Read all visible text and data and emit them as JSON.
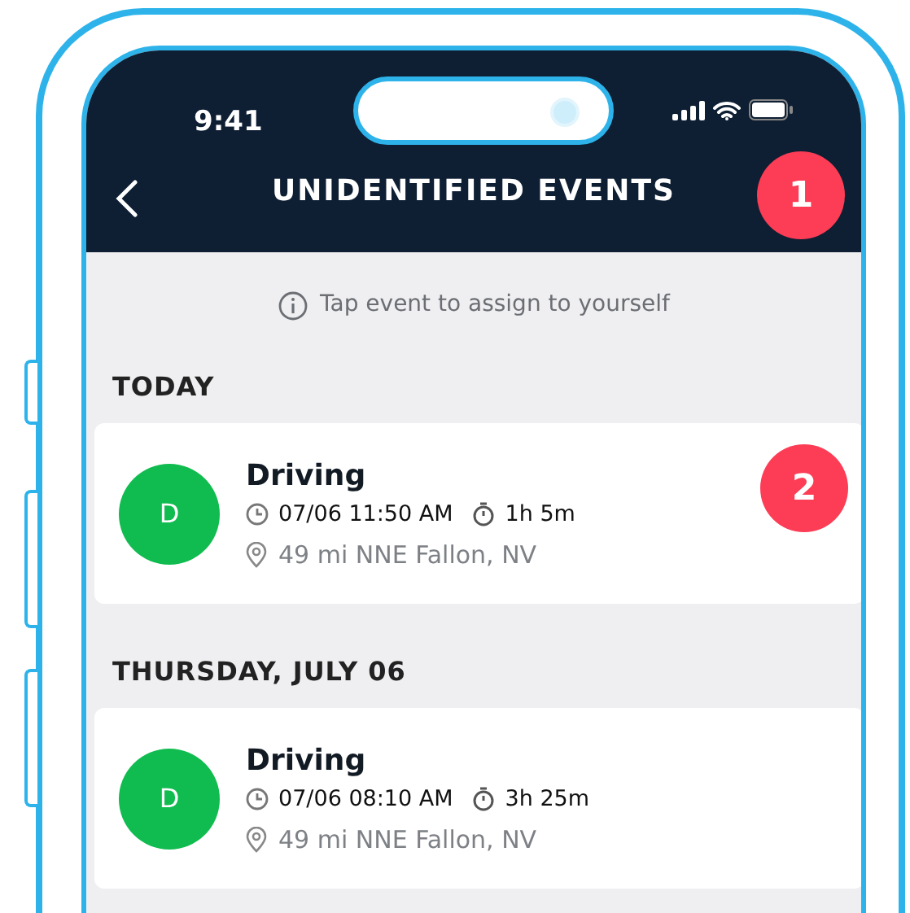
{
  "status_bar": {
    "time": "9:41"
  },
  "header": {
    "title": "UNIDENTIFIED EVENTS",
    "badge": "1"
  },
  "hint": "Tap event to assign to yourself",
  "sections": [
    {
      "heading": "TODAY",
      "events": [
        {
          "avatar": "D",
          "title": "Driving",
          "time": "07/06 11:50 AM",
          "duration": "1h 5m",
          "location": "49 mi NNE Fallon, NV",
          "badge": "2"
        }
      ]
    },
    {
      "heading": "THURSDAY, JULY 06",
      "events": [
        {
          "avatar": "D",
          "title": "Driving",
          "time": "07/06 08:10 AM",
          "duration": "3h 25m",
          "location": "49 mi NNE Fallon, NV"
        }
      ]
    }
  ]
}
